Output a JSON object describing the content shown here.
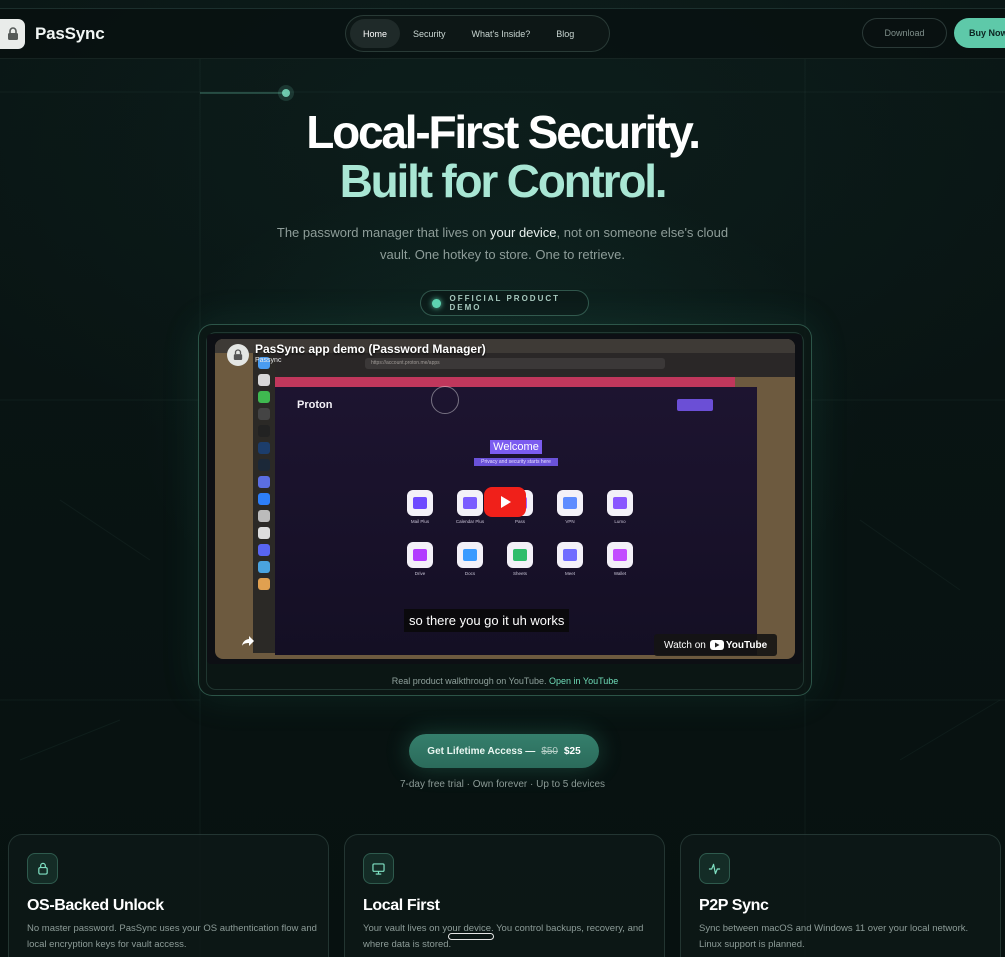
{
  "header": {
    "brand": "PasSync",
    "nav": [
      "Home",
      "Security",
      "What's Inside?",
      "Blog"
    ],
    "active_nav": "Home",
    "download_label": "Download",
    "buy_label": "Buy Now"
  },
  "hero": {
    "title_line1": "Local-First Security.",
    "title_line2": "Built for Control.",
    "sub_before": "The password manager that lives on ",
    "sub_highlight": "your device",
    "sub_after": ", not on someone else's cloud vault. One hotkey to store. One to retrieve.",
    "badge": "OFFICIAL PRODUCT DEMO"
  },
  "video": {
    "title": "PasSync app demo (Password Manager)",
    "channel": "Passync",
    "url": "https://account.proton.me/apps",
    "brand_in_video": "Proton",
    "welcome": "Welcome",
    "welcome_sub": "Privacy and security starts here",
    "apps": [
      {
        "label": "Mail Plus",
        "color": "#6d4aff"
      },
      {
        "label": "Calendar Plus",
        "color": "#7a5cff"
      },
      {
        "label": "Pass",
        "color": "#a25cff"
      },
      {
        "label": "VPN",
        "color": "#5d8bff"
      },
      {
        "label": "Lumo",
        "color": "#8a57ff"
      },
      {
        "label": "Drive",
        "color": "#b23cff"
      },
      {
        "label": "Docs",
        "color": "#3a9bff"
      },
      {
        "label": "Sheets",
        "color": "#2ebd6b"
      },
      {
        "label": "Meet",
        "color": "#6f6bff"
      },
      {
        "label": "Wallet",
        "color": "#c24cff"
      }
    ],
    "caption": "so there you go it uh works",
    "watch_on": "Watch on",
    "youtube": "YouTube",
    "footer_text": "Real product walkthrough on YouTube.",
    "footer_link": "Open in YouTube"
  },
  "cta": {
    "label": "Get Lifetime Access —",
    "old_price": "$50",
    "new_price": "$25",
    "sub": "7-day free trial · Own forever · Up to 5 devices"
  },
  "features": [
    {
      "icon": "lock-icon",
      "title": "OS-Backed Unlock",
      "desc": "No master password. PasSync uses your OS authentication flow and local encryption keys for vault access."
    },
    {
      "icon": "monitor-icon",
      "title": "Local First",
      "desc": "Your vault lives on your device. You control backups, recovery, and where data is stored."
    },
    {
      "icon": "activity-icon",
      "title": "P2P Sync",
      "desc": "Sync between macOS and Windows 11 over your local network. Linux support is planned."
    }
  ],
  "colors": {
    "accent": "#5ec9a9",
    "background": "#081312",
    "title_secondary": "#a9e6d4",
    "youtube_red": "#f0201a"
  }
}
